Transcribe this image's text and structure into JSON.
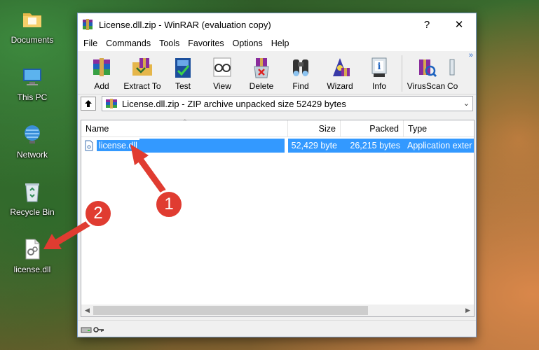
{
  "desktop": {
    "icons": [
      {
        "label": "Documents",
        "icon": "folder-documents-icon"
      },
      {
        "label": "This PC",
        "icon": "computer-icon"
      },
      {
        "label": "Network",
        "icon": "network-icon"
      },
      {
        "label": "Recycle Bin",
        "icon": "recycle-bin-icon"
      },
      {
        "label": "license.dll",
        "icon": "dll-file-icon"
      }
    ]
  },
  "window": {
    "title": "License.dll.zip - WinRAR (evaluation copy)",
    "help_glyph": "?",
    "close_glyph": "✕"
  },
  "menu": [
    "File",
    "Commands",
    "Tools",
    "Favorites",
    "Options",
    "Help"
  ],
  "toolbar": {
    "buttons": [
      {
        "label": "Add",
        "icon": "add-archive-icon"
      },
      {
        "label": "Extract To",
        "icon": "extract-to-icon"
      },
      {
        "label": "Test",
        "icon": "test-icon"
      },
      {
        "label": "View",
        "icon": "view-icon"
      },
      {
        "label": "Delete",
        "icon": "delete-icon"
      },
      {
        "label": "Find",
        "icon": "find-icon"
      },
      {
        "label": "Wizard",
        "icon": "wizard-icon"
      },
      {
        "label": "Info",
        "icon": "info-icon"
      },
      {
        "label": "VirusScan",
        "icon": "virusscan-icon"
      },
      {
        "label": "Co",
        "icon": "comment-icon"
      }
    ],
    "more_glyph": "»"
  },
  "address": {
    "text": "License.dll.zip - ZIP archive unpacked size 52429 bytes"
  },
  "filelist": {
    "columns": [
      "Name",
      "Size",
      "Packed",
      "Type"
    ],
    "rows": [
      {
        "name": "license.dll",
        "size": "52,429 byte",
        "packed": "26,215 bytes",
        "type": "Application exter"
      }
    ]
  },
  "annotations": {
    "badge1": "1",
    "badge2": "2",
    "color": "#e03c31"
  }
}
